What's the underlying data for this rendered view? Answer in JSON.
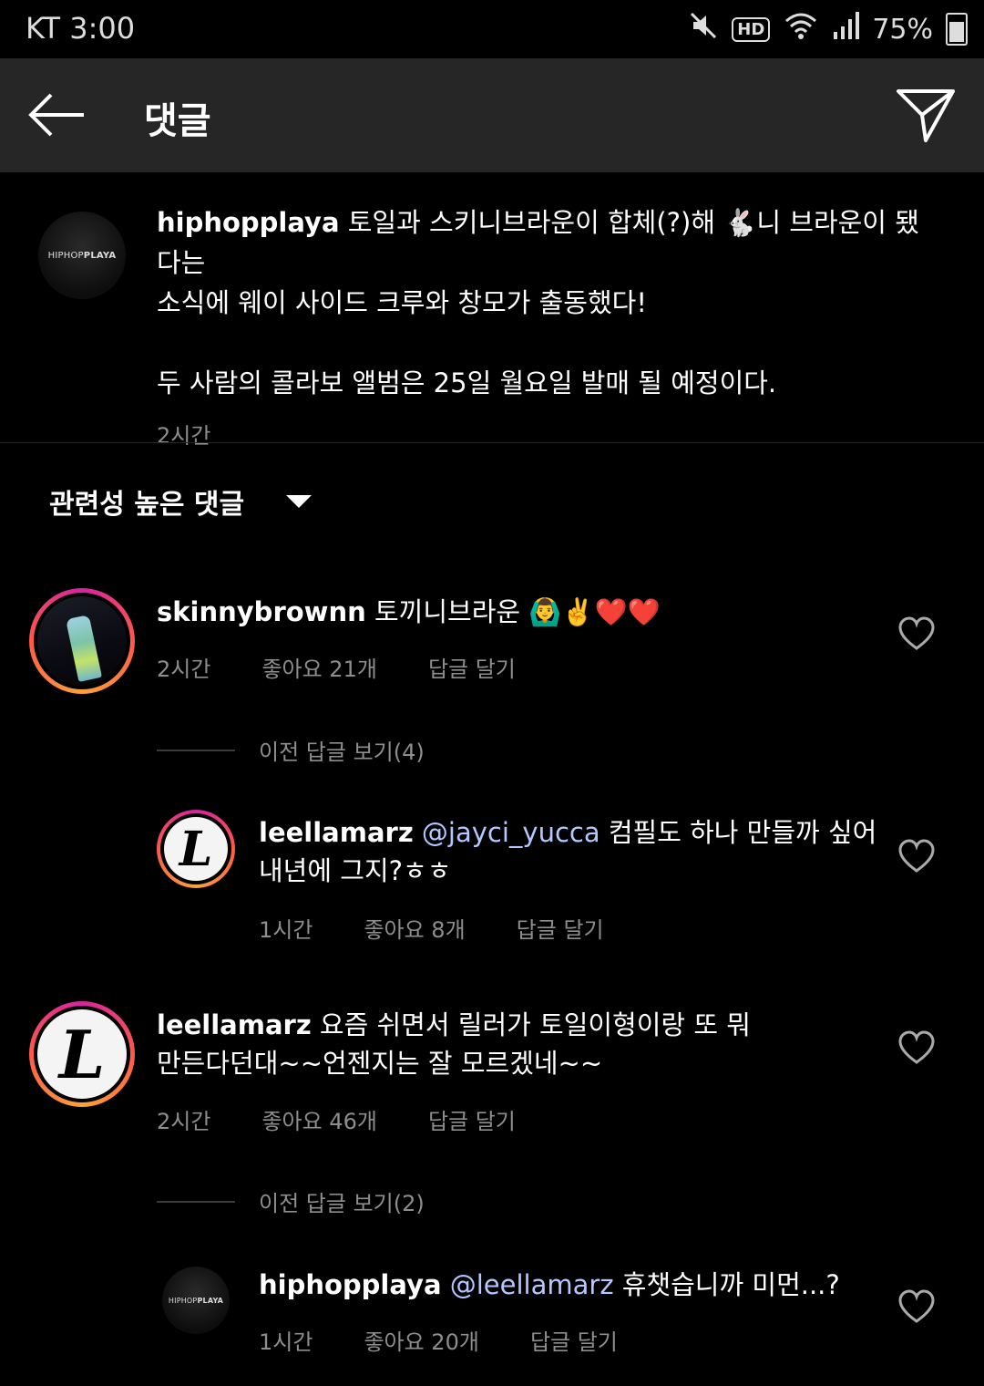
{
  "status_bar": {
    "carrier": "KT",
    "time": "3:00",
    "battery_percent": "75%",
    "hd_label": "HD"
  },
  "app_bar": {
    "title": "댓글",
    "back_icon": "arrow-left-icon",
    "send_icon": "send-icon"
  },
  "post": {
    "avatar_text_a": "HIPHOP",
    "avatar_text_b": "PLAYA",
    "username": "hiphopplaya",
    "line1": " 토일과 스키니브라운이 합체(?)해 🐇니 브라운이 됐다는",
    "line2": "소식에 웨이 사이드 크루와 창모가 출동했다!",
    "line3": "두 사람의 콜라보 앨범은 25일 월요일 발매 될 예정이다.",
    "time": "2시간"
  },
  "sort": {
    "label": "관련성 높은 댓글"
  },
  "comments": [
    {
      "username": "skinnybrownn",
      "text": " 토끼니브라운 🙆‍♂️✌️❤️❤️",
      "time": "2시간",
      "likes": "좋아요 21개",
      "reply": "답글 달기",
      "view_previous": "이전 답글 보기(4)",
      "replies": [
        {
          "avatar_letter": "L",
          "username": "leellamarz",
          "mention": "@jayci_yucca",
          "text_line1": " 컴필도 하나 만들까 싶어",
          "text_line2": "내년에 그지?ㅎㅎ",
          "time": "1시간",
          "likes": "좋아요 8개",
          "reply": "답글 달기"
        }
      ]
    },
    {
      "avatar_letter": "L",
      "username": "leellamarz",
      "text_line1": " 요즘 쉬면서 릴러가 토일이형이랑 또 뭐",
      "text_line2": "만든다던대~~언젠지는 잘 모르겠네~~",
      "time": "2시간",
      "likes": "좋아요 46개",
      "reply": "답글 달기",
      "view_previous": "이전 답글 보기(2)",
      "replies": [
        {
          "avatar_text_a": "HIPHOP",
          "avatar_text_b": "PLAYA",
          "username": "hiphopplaya",
          "mention": "@leellamarz",
          "text_line1": " 휴챗습니까 미먼...?",
          "time": "1시간",
          "likes": "좋아요 20개",
          "reply": "답글 달기"
        }
      ]
    }
  ]
}
